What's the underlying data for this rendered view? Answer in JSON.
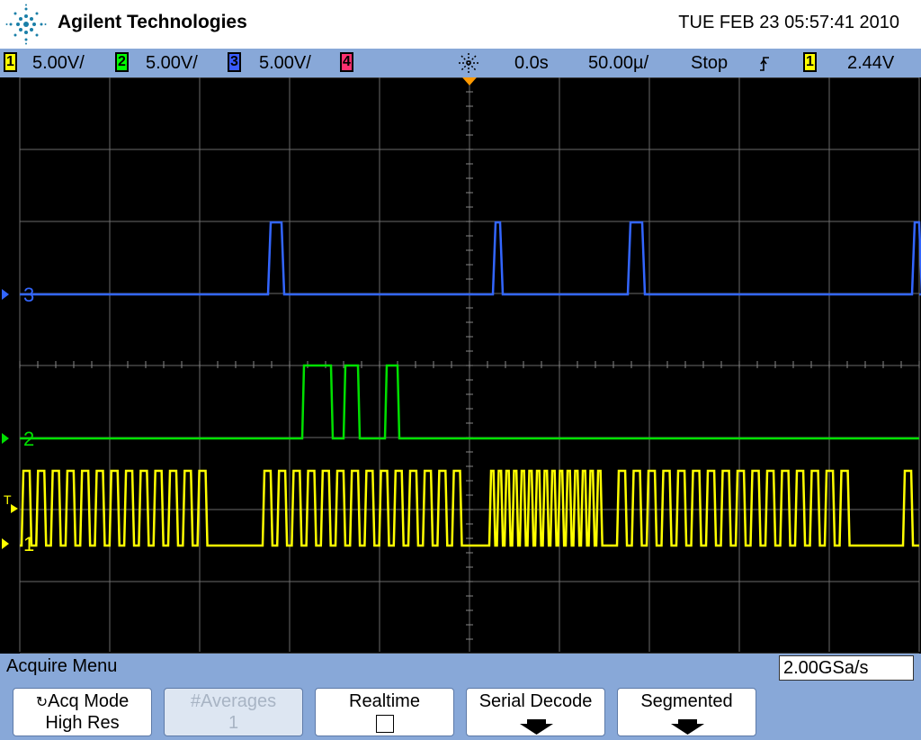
{
  "header": {
    "brand": "Agilent Technologies",
    "datetime": "TUE FEB 23 05:57:41 2010",
    "logo_icon": "agilent-spark-icon"
  },
  "status": {
    "channels": [
      {
        "num": "1",
        "scale": "5.00V/",
        "color": "#ffff00"
      },
      {
        "num": "2",
        "scale": "5.00V/",
        "color": "#00ff00"
      },
      {
        "num": "3",
        "scale": "5.00V/",
        "color": "#3355ff"
      },
      {
        "num": "4",
        "scale": "",
        "color": "#ff3070"
      }
    ],
    "delay": "0.0s",
    "timebase": "50.00µ/",
    "run_state": "Stop",
    "trigger_source": "1",
    "trigger_level": "2.44V"
  },
  "screen": {
    "ch3_label": "3",
    "ch2_label": "2",
    "ch1_label": "1",
    "trigger_marker": "T",
    "colors": {
      "ch1": "#ffff00",
      "ch2": "#00e000",
      "ch3": "#3366ff",
      "grid": "#6a6a6a"
    }
  },
  "menu": {
    "title": "Acquire Menu",
    "sample_rate": "2.00GSa/s",
    "softkeys": [
      {
        "line1": "Acq Mode",
        "line2": "High Res"
      },
      {
        "line1": "#Averages",
        "line2": "1"
      },
      {
        "line1": "Realtime",
        "line2": ""
      },
      {
        "line1": "Serial Decode",
        "line2": ""
      },
      {
        "line1": "Segmented",
        "line2": ""
      }
    ]
  }
}
